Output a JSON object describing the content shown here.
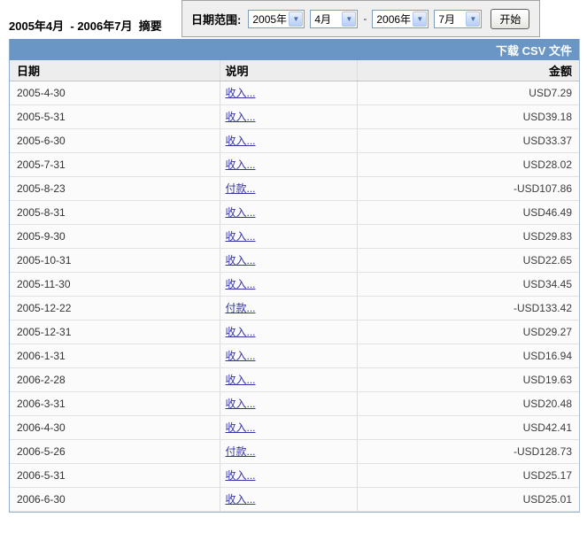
{
  "summary": {
    "title": "2005年4月  - 2006年7月  摘要"
  },
  "date_range": {
    "label": "日期范围:",
    "start_year": "2005年",
    "start_month": "4月",
    "separator": "-",
    "end_year": "2006年",
    "end_month": "7月",
    "start_button": "开始"
  },
  "header_bar": {
    "download_csv": "下载 CSV 文件"
  },
  "table": {
    "headers": {
      "date": "日期",
      "description": "说明",
      "amount": "金额"
    },
    "rows": [
      {
        "date": "2005-4-30",
        "description": "收入...",
        "amount": "USD7.29"
      },
      {
        "date": "2005-5-31",
        "description": "收入...",
        "amount": "USD39.18"
      },
      {
        "date": "2005-6-30",
        "description": "收入...",
        "amount": "USD33.37"
      },
      {
        "date": "2005-7-31",
        "description": "收入...",
        "amount": "USD28.02"
      },
      {
        "date": "2005-8-23",
        "description": "付款...",
        "amount": "-USD107.86"
      },
      {
        "date": "2005-8-31",
        "description": "收入...",
        "amount": "USD46.49"
      },
      {
        "date": "2005-9-30",
        "description": "收入...",
        "amount": "USD29.83"
      },
      {
        "date": "2005-10-31",
        "description": "收入...",
        "amount": "USD22.65"
      },
      {
        "date": "2005-11-30",
        "description": "收入...",
        "amount": "USD34.45"
      },
      {
        "date": "2005-12-22",
        "description": "付款...",
        "amount": "-USD133.42"
      },
      {
        "date": "2005-12-31",
        "description": "收入...",
        "amount": "USD29.27"
      },
      {
        "date": "2006-1-31",
        "description": "收入...",
        "amount": "USD16.94"
      },
      {
        "date": "2006-2-28",
        "description": "收入...",
        "amount": "USD19.63"
      },
      {
        "date": "2006-3-31",
        "description": "收入...",
        "amount": "USD20.48"
      },
      {
        "date": "2006-4-30",
        "description": "收入...",
        "amount": "USD42.41"
      },
      {
        "date": "2006-5-26",
        "description": "付款...",
        "amount": "-USD128.73"
      },
      {
        "date": "2006-5-31",
        "description": "收入...",
        "amount": "USD25.17"
      },
      {
        "date": "2006-6-30",
        "description": "收入...",
        "amount": "USD25.01"
      }
    ]
  },
  "icons": {
    "select_chevron": "▼"
  },
  "colors": {
    "header_bar_bg": "#6A96C6",
    "link": "#3333AA",
    "select_border": "#7F9DB9",
    "panel_bg": "#EFEFEF"
  }
}
